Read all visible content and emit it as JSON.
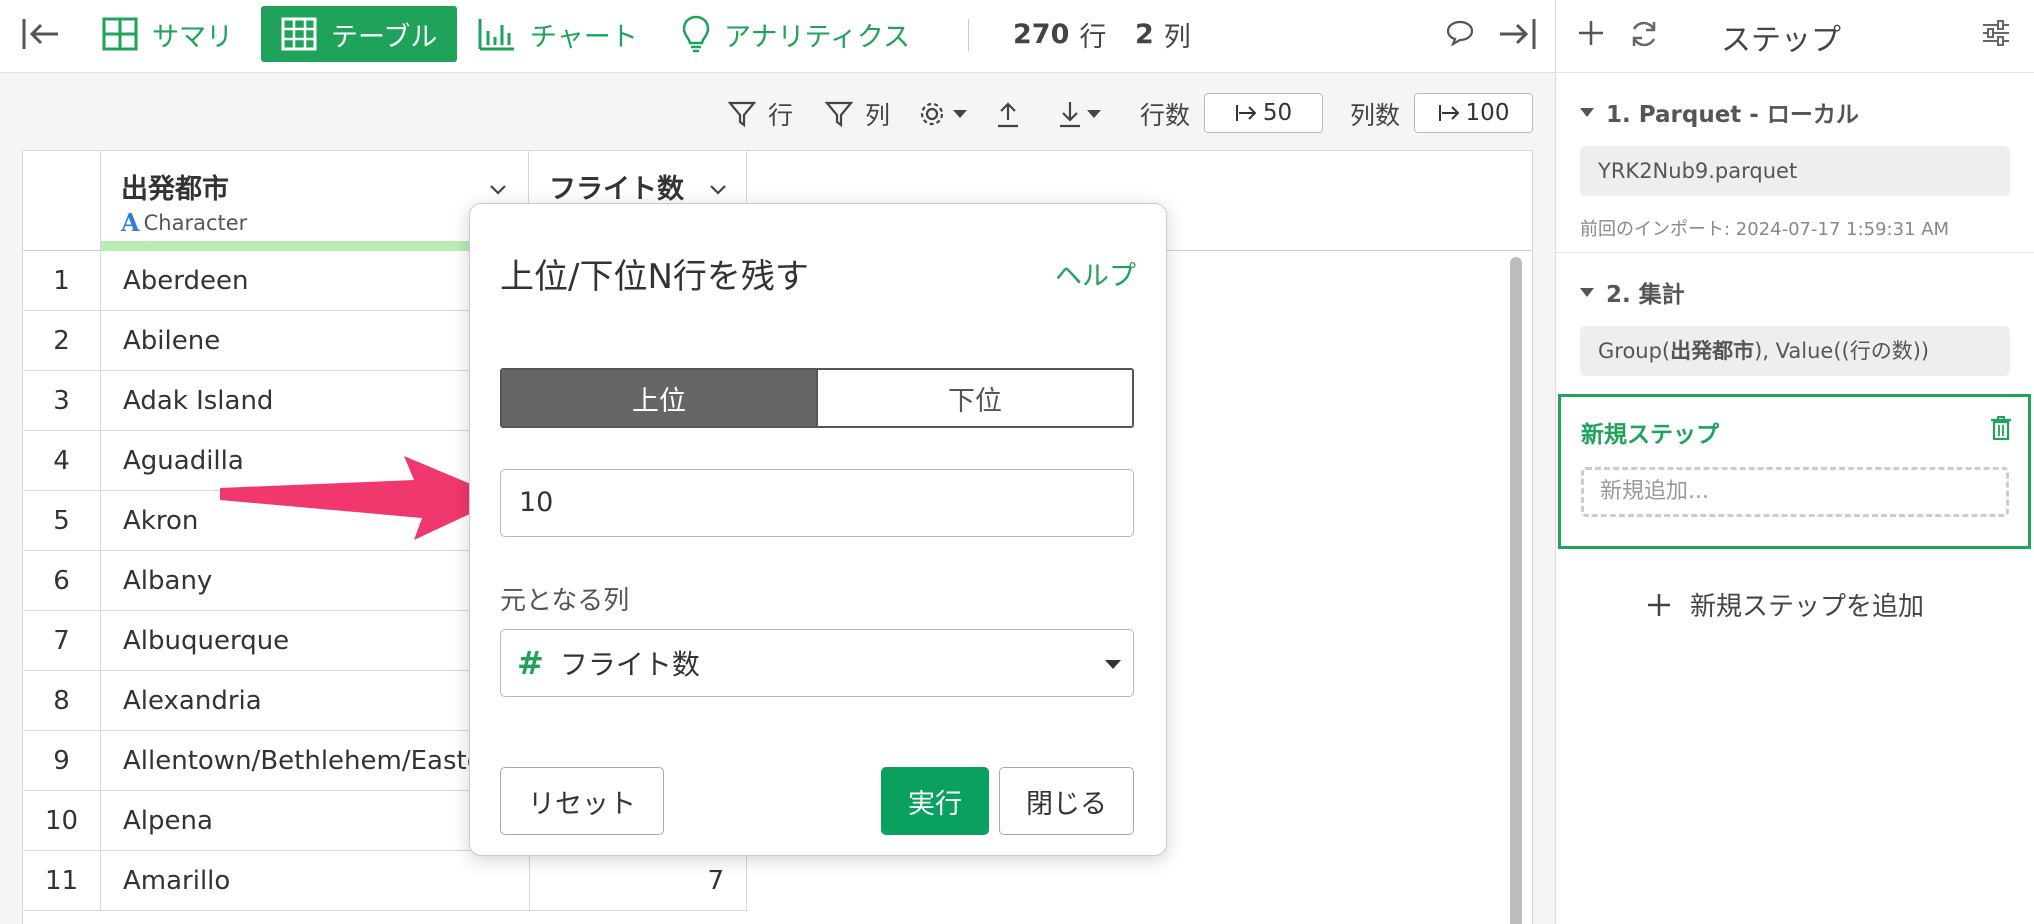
{
  "toolbar": {
    "tabs": [
      {
        "label": "サマリ",
        "icon": "grid-icon"
      },
      {
        "label": "テーブル",
        "icon": "table-icon",
        "active": true
      },
      {
        "label": "チャート",
        "icon": "bar-chart-icon"
      },
      {
        "label": "アナリティクス",
        "icon": "lightbulb-icon"
      }
    ],
    "rows_value": "270",
    "rows_unit": "行",
    "cols_value": "2",
    "cols_unit": "列"
  },
  "subbar": {
    "row_filter": "行",
    "col_filter": "列",
    "row_count_label": "行数",
    "row_count_value": "50",
    "col_count_label": "列数",
    "col_count_value": "100"
  },
  "table": {
    "columns": [
      {
        "title": "出発都市",
        "type": "Character"
      },
      {
        "title": "フライト数"
      }
    ],
    "rows": [
      {
        "n": "1",
        "city": "Aberdeen",
        "value": ""
      },
      {
        "n": "2",
        "city": "Abilene",
        "value": ""
      },
      {
        "n": "3",
        "city": "Adak Island",
        "value": ""
      },
      {
        "n": "4",
        "city": "Aguadilla",
        "value": ""
      },
      {
        "n": "5",
        "city": "Akron",
        "value": ""
      },
      {
        "n": "6",
        "city": "Albany",
        "value": ""
      },
      {
        "n": "7",
        "city": "Albuquerque",
        "value": ""
      },
      {
        "n": "8",
        "city": "Alexandria",
        "value": ""
      },
      {
        "n": "9",
        "city": "Allentown/Bethlehem/Easto",
        "value": ""
      },
      {
        "n": "10",
        "city": "Alpena",
        "value": ""
      },
      {
        "n": "11",
        "city": "Amarillo",
        "value": "7"
      }
    ]
  },
  "modal": {
    "title": "上位/下位N行を残す",
    "help": "ヘルプ",
    "seg_top": "上位",
    "seg_bottom": "下位",
    "n_value": "10",
    "column_label": "元となる列",
    "column_value": "フライト数",
    "reset": "リセット",
    "run": "実行",
    "close": "閉じる"
  },
  "steps_panel": {
    "title": "ステップ",
    "steps": [
      {
        "title": "1. Parquet - ローカル",
        "detail": "YRK2Nub9.parquet",
        "note": "前回のインポート: 2024-07-17 1:59:31 AM"
      },
      {
        "title": "2. 集計",
        "detail_prefix": "Group(",
        "detail_bold": "出発都市",
        "detail_suffix": "), Value((行の数))"
      }
    ],
    "new_step_title": "新規ステップ",
    "new_step_placeholder": "新規追加...",
    "add_step": "新規ステップを追加"
  },
  "colors": {
    "accent": "#1fa35a",
    "primary_button": "#0aa160",
    "arrow": "#f0386f",
    "type_bar": "#b9ecb6"
  }
}
